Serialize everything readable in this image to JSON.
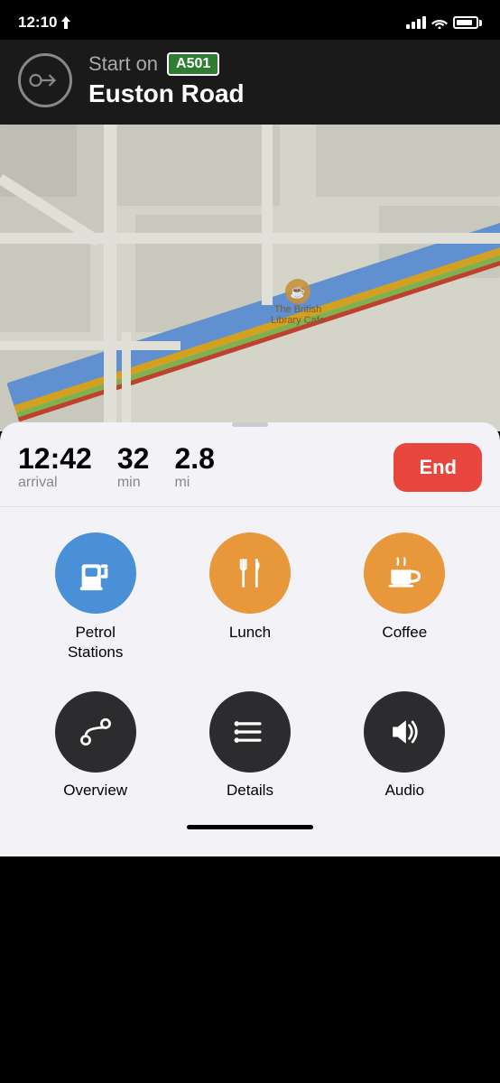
{
  "statusBar": {
    "time": "12:10",
    "hasLocation": true
  },
  "navHeader": {
    "startLabel": "Start on",
    "roadBadge": "A501",
    "roadName": "Euston Road"
  },
  "mapPOI": {
    "name": "The British Library Cafe"
  },
  "tripInfo": {
    "arrival": "12:42",
    "arrivalLabel": "arrival",
    "minutes": "32",
    "minutesLabel": "min",
    "miles": "2.8",
    "milesLabel": "mi",
    "endButton": "End"
  },
  "poiItems": [
    {
      "label": "Petrol\nStations",
      "color": "blue",
      "icon": "⛽"
    },
    {
      "label": "Lunch",
      "color": "orange",
      "icon": "🍴"
    },
    {
      "label": "Coffee",
      "color": "orange",
      "icon": "☕"
    }
  ],
  "actionItems": [
    {
      "label": "Overview",
      "icon": "route"
    },
    {
      "label": "Details",
      "icon": "list"
    },
    {
      "label": "Audio",
      "icon": "audio"
    }
  ]
}
